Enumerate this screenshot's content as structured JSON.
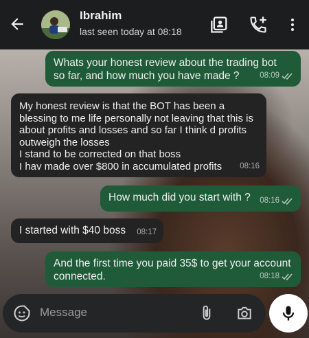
{
  "header": {
    "contact_name": "Ibrahim",
    "status": "last seen today at 08:18",
    "icons": [
      "back-arrow-icon",
      "avatar",
      "contact-card-icon",
      "add-call-icon",
      "more-vert-icon"
    ]
  },
  "messages": [
    {
      "direction": "outgoing",
      "text": "Whats your honest review about the trading bot so far, and how much you have made ?",
      "time": "08:09",
      "read": true
    },
    {
      "direction": "incoming",
      "text": "My honest review is that the BOT has been a blessing to me life personally not leaving that this is about profits and losses and so far I think d profits outweigh the losses\nI stand to be corrected on that boss\nI hav made over $800 in accumulated profits",
      "time": "08:16"
    },
    {
      "direction": "outgoing",
      "text": "How much did you start with ?",
      "time": "08:16",
      "read": true
    },
    {
      "direction": "incoming",
      "text": "I started with $40 boss",
      "time": "08:17"
    },
    {
      "direction": "outgoing",
      "text": "And the first time you paid 35$ to get your account connected.",
      "time": "08:18",
      "read": true
    }
  ],
  "composer": {
    "placeholder": "Message"
  },
  "colors": {
    "outgoing_bubble": "#1f5b39",
    "incoming_bubble": "#232323",
    "header_bg": "#1b1d1e",
    "read_ticks": "#53bdeb"
  }
}
